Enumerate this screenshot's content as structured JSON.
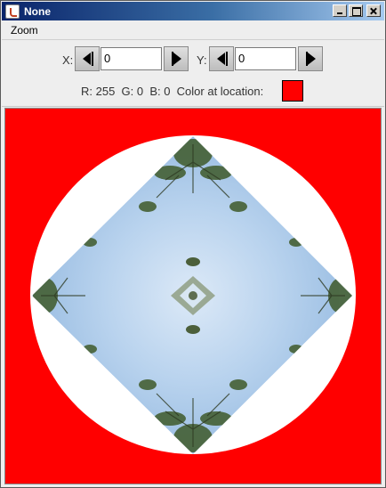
{
  "window": {
    "title": "None",
    "title_icon": "java-cup-icon"
  },
  "menu": {
    "items": [
      {
        "label": "Zoom"
      }
    ]
  },
  "position": {
    "x_label": "X:",
    "x_value": "0",
    "y_label": "Y:",
    "y_value": "0"
  },
  "color_info": {
    "text": "R: 255  G: 0  B: 0  Color at location:",
    "swatch_color": "#ff0000"
  },
  "image": {
    "background_color": "#ff0000",
    "circle_color": "#ffffff",
    "content": "kaleidoscope sky and tree diamond"
  }
}
